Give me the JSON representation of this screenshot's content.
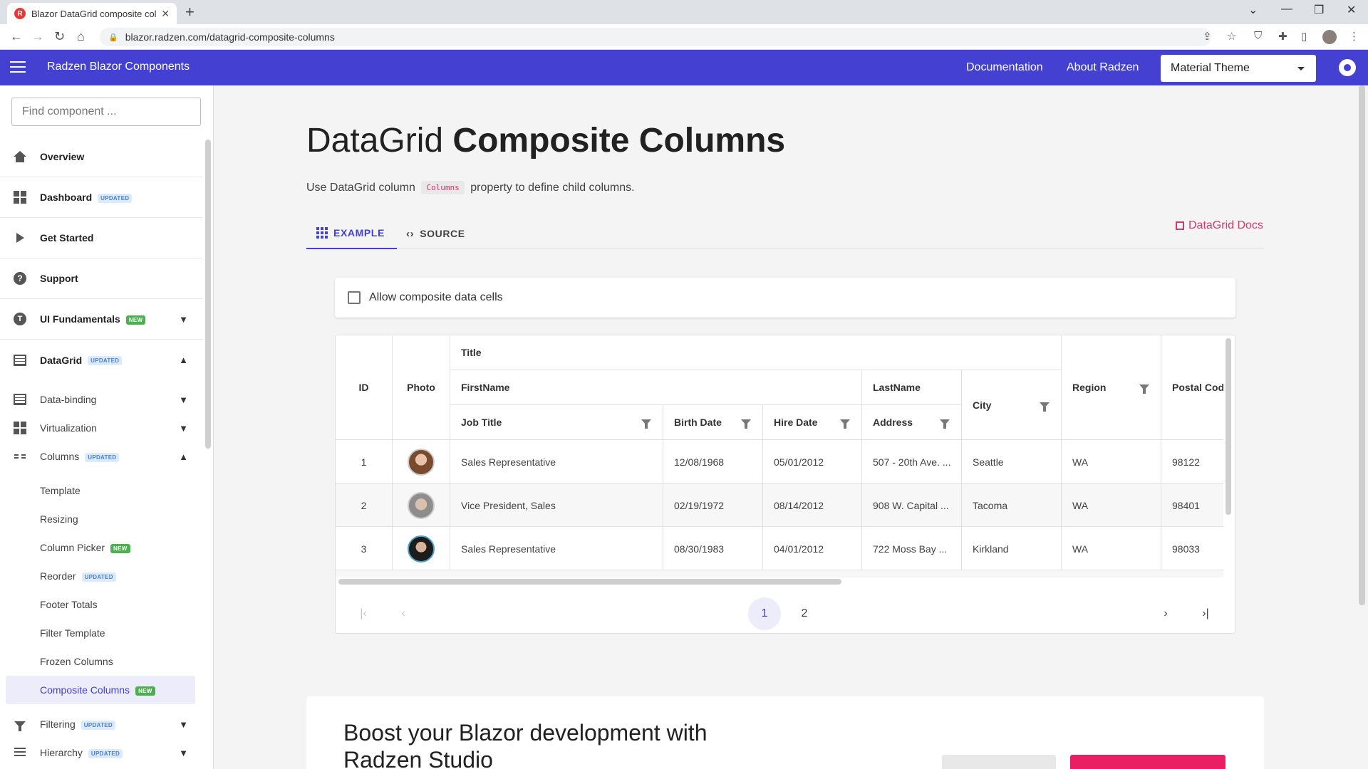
{
  "browser": {
    "tab_title": "Blazor DataGrid composite colum",
    "url": "blazor.radzen.com/datagrid-composite-columns"
  },
  "header": {
    "app_title": "Radzen Blazor Components",
    "links": [
      "Documentation",
      "About Radzen"
    ],
    "theme_value": "Material Theme"
  },
  "sidebar": {
    "search_placeholder": "Find component ...",
    "items": [
      {
        "label": "Overview",
        "badge": ""
      },
      {
        "label": "Dashboard",
        "badge": "UPDATED"
      },
      {
        "label": "Get Started",
        "badge": ""
      },
      {
        "label": "Support",
        "badge": ""
      },
      {
        "label": "UI Fundamentals",
        "badge": "NEW"
      },
      {
        "label": "DataGrid",
        "badge": "UPDATED"
      }
    ],
    "subitems": [
      {
        "label": "Data-binding",
        "badge": ""
      },
      {
        "label": "Virtualization",
        "badge": ""
      },
      {
        "label": "Columns",
        "badge": "UPDATED"
      }
    ],
    "leaves": [
      {
        "label": "Template",
        "badge": ""
      },
      {
        "label": "Resizing",
        "badge": ""
      },
      {
        "label": "Column Picker",
        "badge": "NEW"
      },
      {
        "label": "Reorder",
        "badge": "UPDATED"
      },
      {
        "label": "Footer Totals",
        "badge": ""
      },
      {
        "label": "Filter Template",
        "badge": ""
      },
      {
        "label": "Frozen Columns",
        "badge": ""
      },
      {
        "label": "Composite Columns",
        "badge": "NEW"
      }
    ],
    "bottom": [
      {
        "label": "Filtering",
        "badge": "UPDATED"
      },
      {
        "label": "Hierarchy",
        "badge": "UPDATED"
      }
    ]
  },
  "page": {
    "title_light": "DataGrid",
    "title_bold": "Composite Columns",
    "desc_before": "Use DataGrid column",
    "desc_code": "Columns",
    "desc_after": "property to define child columns.",
    "tab_example": "EXAMPLE",
    "tab_source": "SOURCE",
    "docs_link": "DataGrid Docs",
    "checkbox_label": "Allow composite data cells"
  },
  "grid": {
    "headers": {
      "id": "ID",
      "photo": "Photo",
      "title": "Title",
      "firstname": "FirstName",
      "lastname": "LastName",
      "jobtitle": "Job Title",
      "birthdate": "Birth Date",
      "hiredate": "Hire Date",
      "address": "Address",
      "city": "City",
      "region": "Region",
      "postal": "Postal Code"
    },
    "rows": [
      {
        "id": "1",
        "job": "Sales Representative",
        "birth": "12/08/1968",
        "hire": "05/01/2012",
        "address": "507 - 20th Ave. ...",
        "city": "Seattle",
        "region": "WA",
        "postal": "98122"
      },
      {
        "id": "2",
        "job": "Vice President, Sales",
        "birth": "02/19/1972",
        "hire": "08/14/2012",
        "address": "908 W. Capital ...",
        "city": "Tacoma",
        "region": "WA",
        "postal": "98401"
      },
      {
        "id": "3",
        "job": "Sales Representative",
        "birth": "08/30/1983",
        "hire": "04/01/2012",
        "address": "722 Moss Bay ...",
        "city": "Kirkland",
        "region": "WA",
        "postal": "98033"
      }
    ],
    "pager": {
      "pages": [
        "1",
        "2"
      ],
      "current": "1"
    }
  },
  "promo": {
    "title": "Boost your Blazor development with Radzen Studio"
  },
  "colors": {
    "primary": "#4340d2",
    "accent": "#d63a6a",
    "new_badge": "#4caf50"
  }
}
